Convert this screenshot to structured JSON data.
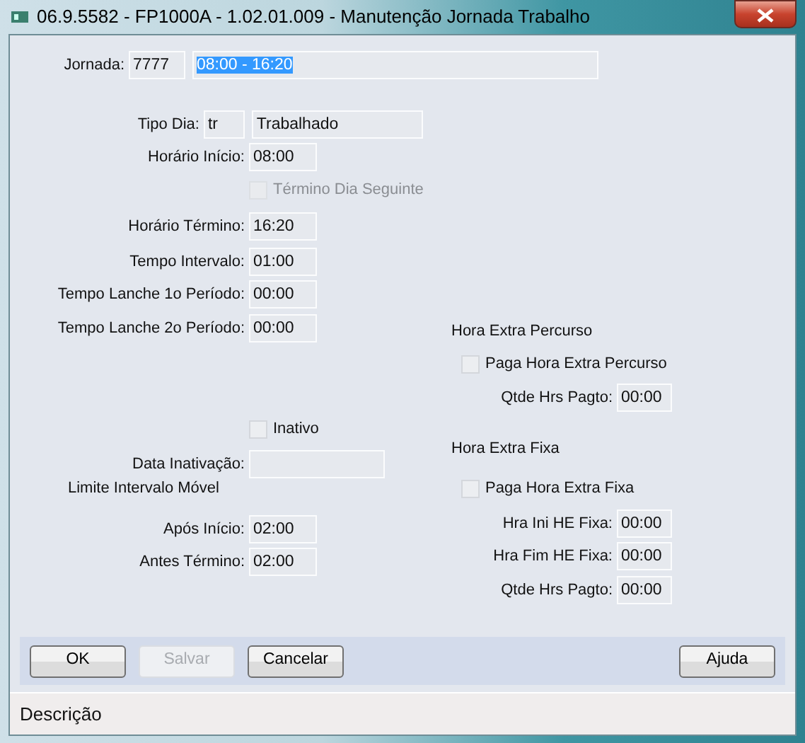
{
  "window": {
    "title": "06.9.5582 - FP1000A - 1.02.01.009 - Manutenção Jornada Trabalho"
  },
  "jornada": {
    "label": "Jornada:",
    "code": "7777",
    "description": "08:00 - 16:20",
    "description_selected": true
  },
  "left": [
    {
      "kind": "code-field",
      "label": "Tipo Dia:",
      "value": "tr",
      "description": "Trabalhado"
    },
    {
      "kind": "time-field",
      "label": "Horário Início:",
      "value": "08:00"
    },
    {
      "kind": "checkbox",
      "label": "Término Dia Seguinte",
      "checked": false,
      "disabled": true
    },
    {
      "kind": "time-field",
      "label": "Horário Término:",
      "value": "16:20"
    },
    {
      "kind": "time-field",
      "label": "Tempo Intervalo:",
      "value": "01:00"
    },
    {
      "kind": "time-field",
      "label": "Tempo Lanche 1o Período:",
      "value": "00:00"
    },
    {
      "kind": "time-field",
      "label": "Tempo Lanche 2o Período:",
      "value": "00:00"
    },
    {
      "kind": "checkbox",
      "label": "Inativo",
      "checked": false,
      "disabled": false
    },
    {
      "kind": "date-field",
      "label": "Data Inativação:"
    },
    {
      "kind": "heading",
      "label": "Limite Intervalo Móvel"
    },
    {
      "kind": "time-field",
      "label": "Após Início:",
      "value": "02:00"
    },
    {
      "kind": "time-field",
      "label": "Antes Término:",
      "value": "02:00"
    }
  ],
  "right": [
    {
      "kind": "heading",
      "label": "Hora Extra Percurso"
    },
    {
      "kind": "checkbox",
      "label": "Paga Hora Extra Percurso",
      "checked": false,
      "disabled": false
    },
    {
      "kind": "time-field",
      "label": "Qtde Hrs Pagto:",
      "value": "00:00"
    },
    {
      "kind": "heading",
      "label": "Hora Extra Fixa"
    },
    {
      "kind": "checkbox",
      "label": "Paga Hora Extra Fixa",
      "checked": false,
      "disabled": false
    },
    {
      "kind": "time-field",
      "label": "Hra Ini HE Fixa:",
      "value": "00:00"
    },
    {
      "kind": "time-field",
      "label": "Hra Fim HE Fixa:",
      "value": "00:00"
    },
    {
      "kind": "time-field",
      "label": "Qtde Hrs Pagto:",
      "value": "00:00"
    }
  ],
  "buttons": [
    {
      "label": "OK",
      "disabled": false
    },
    {
      "label": "Salvar",
      "disabled": true
    },
    {
      "label": "Cancelar",
      "disabled": false
    }
  ],
  "help_button": {
    "label": "Ajuda",
    "disabled": false
  },
  "status_bar": {
    "text": "Descrição"
  }
}
